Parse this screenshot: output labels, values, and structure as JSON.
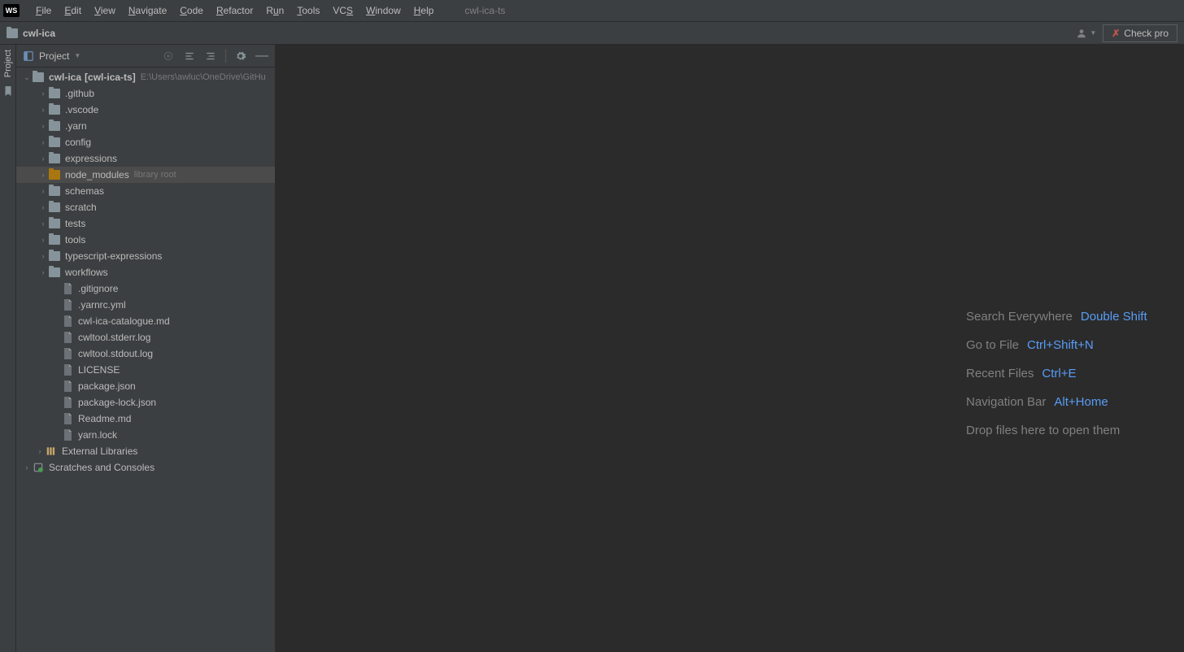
{
  "app": {
    "icon": "WS",
    "title": "cwl-ica-ts"
  },
  "menu": [
    "File",
    "Edit",
    "View",
    "Navigate",
    "Code",
    "Refactor",
    "Run",
    "Tools",
    "VCS",
    "Window",
    "Help"
  ],
  "nav": {
    "project": "cwl-ica",
    "check": "Check pro"
  },
  "panel": {
    "title": "Project"
  },
  "tree": {
    "root": {
      "name": "cwl-ica",
      "bracket": "[cwl-ica-ts]",
      "path": "E:\\Users\\awluc\\OneDrive\\GitHu"
    },
    "folders": [
      {
        "name": ".github",
        "hint": ""
      },
      {
        "name": ".vscode",
        "hint": ""
      },
      {
        "name": ".yarn",
        "hint": ""
      },
      {
        "name": "config",
        "hint": ""
      },
      {
        "name": "expressions",
        "hint": ""
      },
      {
        "name": "node_modules",
        "hint": "library root",
        "selected": true,
        "special": true
      },
      {
        "name": "schemas",
        "hint": ""
      },
      {
        "name": "scratch",
        "hint": ""
      },
      {
        "name": "tests",
        "hint": ""
      },
      {
        "name": "tools",
        "hint": ""
      },
      {
        "name": "typescript-expressions",
        "hint": ""
      },
      {
        "name": "workflows",
        "hint": ""
      }
    ],
    "files": [
      ".gitignore",
      ".yarnrc.yml",
      "cwl-ica-catalogue.md",
      "cwltool.stderr.log",
      "cwltool.stdout.log",
      "LICENSE",
      "package.json",
      "package-lock.json",
      "Readme.md",
      "yarn.lock"
    ],
    "externals": "External Libraries",
    "scratches": "Scratches and Consoles"
  },
  "editor_help": [
    {
      "label": "Search Everywhere",
      "key": "Double Shift"
    },
    {
      "label": "Go to File",
      "key": "Ctrl+Shift+N"
    },
    {
      "label": "Recent Files",
      "key": "Ctrl+E"
    },
    {
      "label": "Navigation Bar",
      "key": "Alt+Home"
    },
    {
      "label": "Drop files here to open them",
      "key": ""
    }
  ],
  "rail": {
    "project": "Project"
  }
}
